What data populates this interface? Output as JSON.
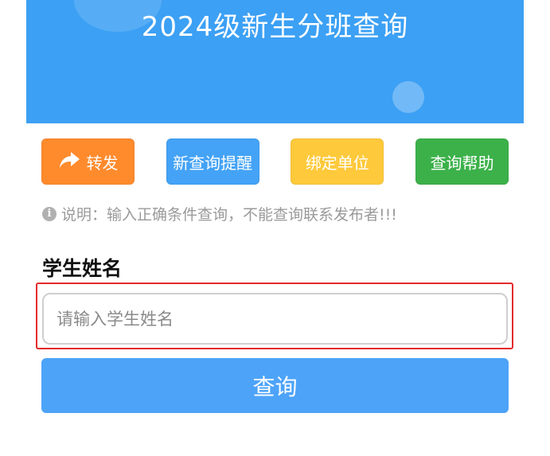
{
  "header": {
    "title": "2024级新生分班查询",
    "banner_color": "#3ca0f4"
  },
  "actions": [
    {
      "label": "转发",
      "icon": "share-arrow-icon",
      "color": "#ff8b2d"
    },
    {
      "label": "新查询提醒",
      "color": "#44a3f6"
    },
    {
      "label": "绑定单位",
      "color": "#fec93b"
    },
    {
      "label": "查询帮助",
      "color": "#3cb14a"
    }
  ],
  "notice": {
    "icon": "info-icon",
    "text": "说明：输入正确条件查询，不能查询联系发布者!!!"
  },
  "form": {
    "field_label": "学生姓名",
    "name_placeholder": "请输入学生姓名",
    "name_value": "",
    "submit_label": "查询",
    "submit_color": "#4da3f8",
    "highlight_color": "#e42a2a"
  }
}
